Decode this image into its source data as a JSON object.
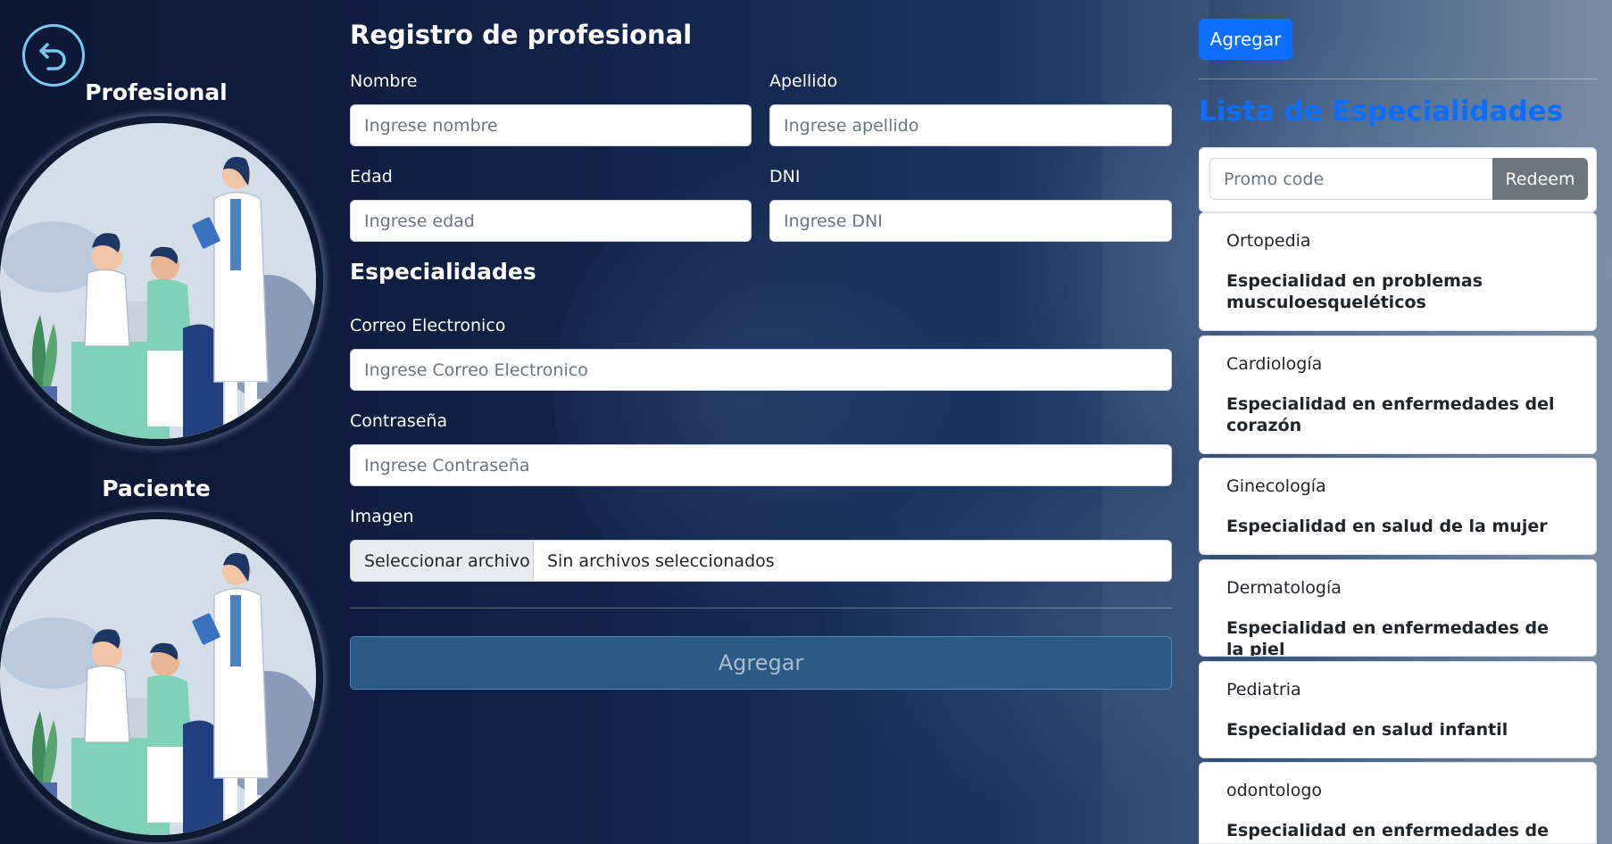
{
  "left": {
    "profesional_title": "Profesional",
    "paciente_title": "Paciente"
  },
  "form": {
    "title": "Registro de profesional",
    "nombre_label": "Nombre",
    "nombre_placeholder": "Ingrese nombre",
    "apellido_label": "Apellido",
    "apellido_placeholder": "Ingrese apellido",
    "edad_label": "Edad",
    "edad_placeholder": "Ingrese edad",
    "dni_label": "DNI",
    "dni_placeholder": "Ingrese DNI",
    "especialidades_title": "Especialidades",
    "correo_label": "Correo Electronico",
    "correo_placeholder": "Ingrese Correo Electronico",
    "contrasena_label": "Contraseña",
    "contrasena_placeholder": "Ingrese Contraseña",
    "imagen_label": "Imagen",
    "file_button": "Seleccionar archivo",
    "file_status": "Sin archivos seleccionados",
    "submit_label": "Agregar"
  },
  "right": {
    "add_button": "Agregar",
    "list_title": "Lista de Especialidades",
    "promo_placeholder": "Promo code",
    "redeem_label": "Redeem",
    "specialties": [
      {
        "name": "Ortopedia",
        "description": "Especialidad en problemas musculoesqueléticos"
      },
      {
        "name": "Cardiología",
        "description": "Especialidad en enfermedades del corazón"
      },
      {
        "name": "Ginecología",
        "description": "Especialidad en salud de la mujer"
      },
      {
        "name": "Dermatología",
        "description": "Especialidad en enfermedades de la piel"
      },
      {
        "name": "Pediatria",
        "description": "Especialidad en salud infantil"
      },
      {
        "name": "odontologo",
        "description": "Especialidad en enfermedades de los"
      }
    ]
  },
  "colors": {
    "primary": "#0d6efd",
    "back_ring": "#79c8f2",
    "secondary": "#6c757d"
  },
  "icons": {
    "back": "undo-arrow-icon"
  }
}
